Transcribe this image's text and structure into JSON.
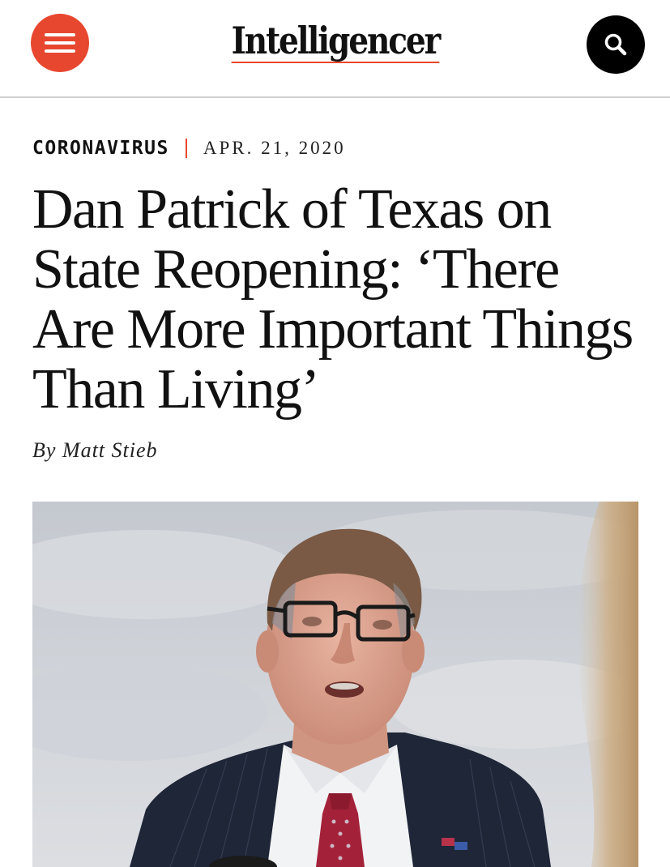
{
  "header": {
    "menu_icon": "hamburger-menu-icon",
    "brand": "Intelligencer",
    "search_icon": "search-icon",
    "menu_color": "#e8472f",
    "search_color": "#000000"
  },
  "article": {
    "rubric": "CORONAVIRUS",
    "date": "APR. 21, 2020",
    "headline": "Dan Patrick of Texas on State Reopening: ‘There Are More Important Things Than Living’",
    "byline_prefix": "By",
    "author": "Matt Stieb",
    "accent_color": "#e8472f"
  },
  "lead_image": {
    "subject": "photo of a man in glasses, suit and red tie speaking outdoors under a cloudy sky"
  }
}
